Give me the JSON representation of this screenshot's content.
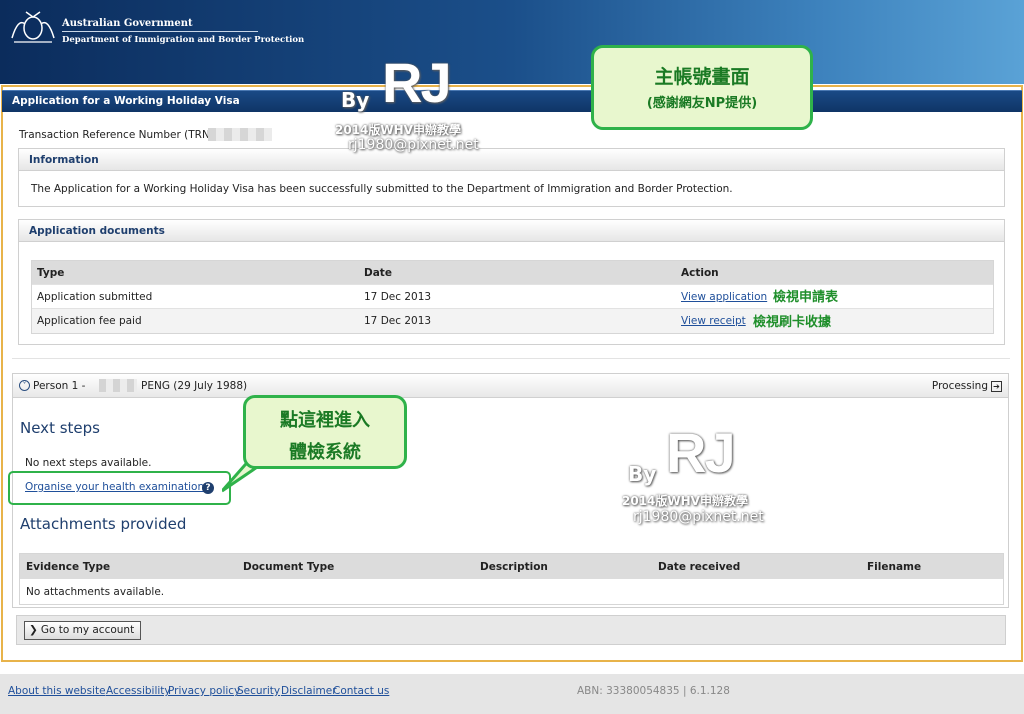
{
  "header": {
    "line1": "Australian Government",
    "line2": "Department of Immigration and Border Protection"
  },
  "page": {
    "title": "Application for a Working Holiday Visa",
    "trn_label": "Transaction Reference Number (TRN):"
  },
  "information": {
    "heading": "Information",
    "text": "The Application for a Working Holiday Visa has been successfully submitted to the Department of Immigration and Border Protection."
  },
  "documents": {
    "heading": "Application documents",
    "columns": [
      "Type",
      "Date",
      "Action"
    ],
    "rows": [
      {
        "type": "Application submitted",
        "date": "17 Dec 2013",
        "action": "View application",
        "note": "檢視申請表"
      },
      {
        "type": "Application fee paid",
        "date": "17 Dec 2013",
        "action": "View receipt",
        "note": "檢視刷卡收據"
      }
    ]
  },
  "person": {
    "prefix": "Person 1 -",
    "name": "PENG (29 July 1988)",
    "status": "Processing"
  },
  "next_steps": {
    "heading": "Next steps",
    "empty": "No next steps available.",
    "health_link": "Organise your health examinations"
  },
  "attachments": {
    "heading": "Attachments provided",
    "columns": [
      "Evidence Type",
      "Document Type",
      "Description",
      "Date received",
      "Filename"
    ],
    "empty": "No attachments available."
  },
  "actions": {
    "go_account": "Go to my account"
  },
  "footer": {
    "links": [
      "About this website",
      "Accessibility",
      "Privacy policy",
      "Security",
      "Disclaimer",
      "Contact us"
    ],
    "abn": "ABN: 33380054835 | 6.1.128"
  },
  "annotations": {
    "main_title": "主帳號畫面",
    "main_sub": "(感謝網友NP提供)",
    "health_l1": "點這裡進入",
    "health_l2": "體檢系統"
  },
  "watermark": {
    "by": "By",
    "rj": "RJ",
    "sub": "2014版WHV申辦教學",
    "mail": "rj1980@pixnet.net"
  },
  "colors": {
    "header_dark": "#0b2c5c",
    "title_bar": "#0f3566",
    "frame_border": "#e8b34a",
    "callout_border": "#2fb24a",
    "callout_fill": "#e8f7ce",
    "link": "#1f4f9a"
  }
}
